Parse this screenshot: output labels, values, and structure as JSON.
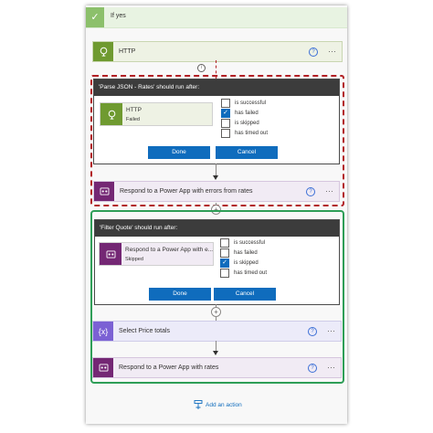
{
  "if_yes": {
    "label": "If yes"
  },
  "http_card": {
    "title": "HTTP",
    "icon": "globe-icon",
    "help": "?",
    "more": "···"
  },
  "info_marker": "i",
  "parse_dialog": {
    "title": "'Parse JSON - Rates' should run after:",
    "action_title": "HTTP",
    "action_status": "Failed",
    "options": [
      {
        "label": "is successful",
        "checked": false
      },
      {
        "label": "has failed",
        "checked": true
      },
      {
        "label": "is skipped",
        "checked": false
      },
      {
        "label": "has timed out",
        "checked": false
      }
    ],
    "done_label": "Done",
    "cancel_label": "Cancel"
  },
  "respond_errors_card": {
    "title": "Respond to a Power App with errors from rates",
    "help": "?",
    "more": "···"
  },
  "filter_dialog": {
    "title": "'Filter Quote' should run after:",
    "action_title": "Respond to a Power App with e...",
    "action_status": "Skipped",
    "options": [
      {
        "label": "is successful",
        "checked": false
      },
      {
        "label": "has failed",
        "checked": false
      },
      {
        "label": "is skipped",
        "checked": true
      },
      {
        "label": "has timed out",
        "checked": false
      }
    ],
    "done_label": "Done",
    "cancel_label": "Cancel"
  },
  "select_card": {
    "title": "Select Price totals",
    "icon_text": "{x}",
    "help": "?",
    "more": "···"
  },
  "respond_rates_card": {
    "title": "Respond to a Power App with rates",
    "help": "?",
    "more": "···"
  },
  "add_action": {
    "label": "Add an action"
  },
  "colors": {
    "http_green": "#6f9a30",
    "power_apps_purple": "#742774",
    "data_ops_violet": "#7b61d4",
    "primary_blue": "#0f6cbd",
    "red_highlight": "#b21f24",
    "green_highlight": "#2e9e57"
  }
}
